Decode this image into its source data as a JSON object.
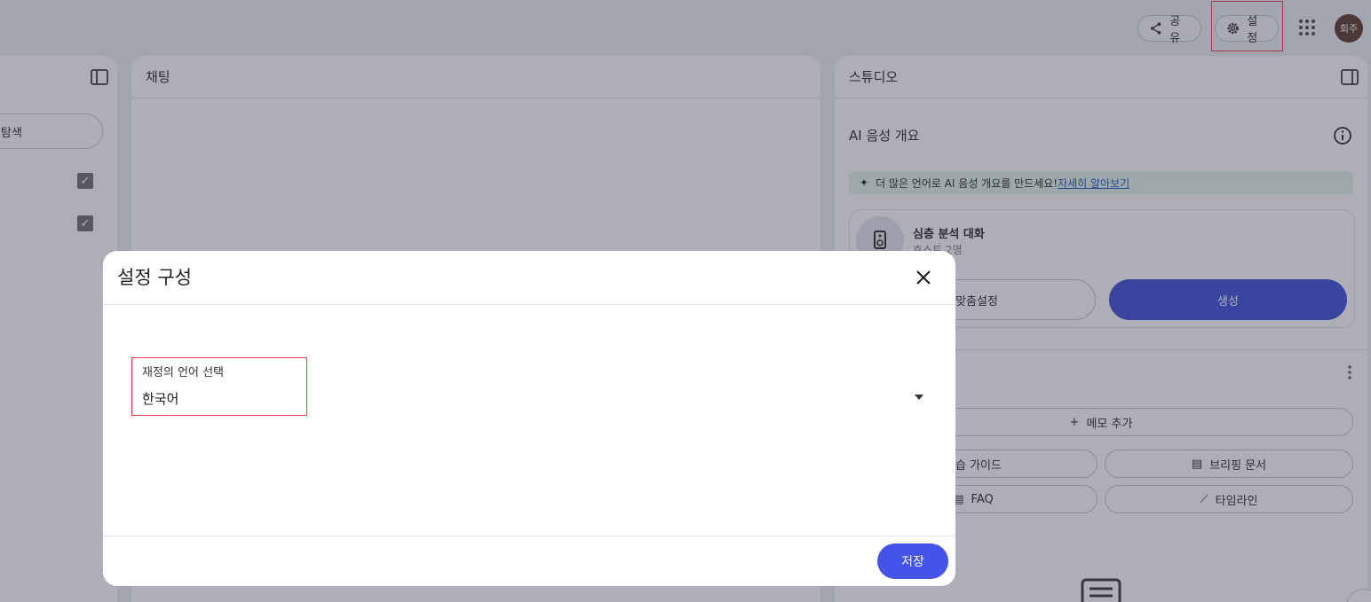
{
  "header": {
    "share_label": "공유",
    "settings_label": "설정",
    "avatar_text": "회주"
  },
  "left_panel": {
    "explore_label": "탐색"
  },
  "chat_panel": {
    "title": "채팅"
  },
  "studio": {
    "title": "스튜디오",
    "ai_section_title": "AI 음성 개요",
    "promo_text": "더 많은 언어로 AI 음성 개요를 만드세요!",
    "promo_link": "자세히 알아보기",
    "card_title": "심층 분석 대화",
    "card_subtitle": "호스트 2명",
    "customize_label": "맞춤설정",
    "generate_label": "생성",
    "note_add_label": "메모 추가",
    "study_guide_label": "학습 가이드",
    "briefing_label": "브리핑 문서",
    "faq_label": "FAQ",
    "timeline_label": "타임라인"
  },
  "dialog": {
    "title": "설정 구성",
    "field_label": "재정의 언어 선택",
    "field_value": "한국어",
    "save_label": "저장"
  },
  "colors": {
    "primary": "#3a4bd8",
    "save": "#4554e8",
    "highlight": "#e03a3a",
    "promo_bg": "#e6f4ea"
  }
}
